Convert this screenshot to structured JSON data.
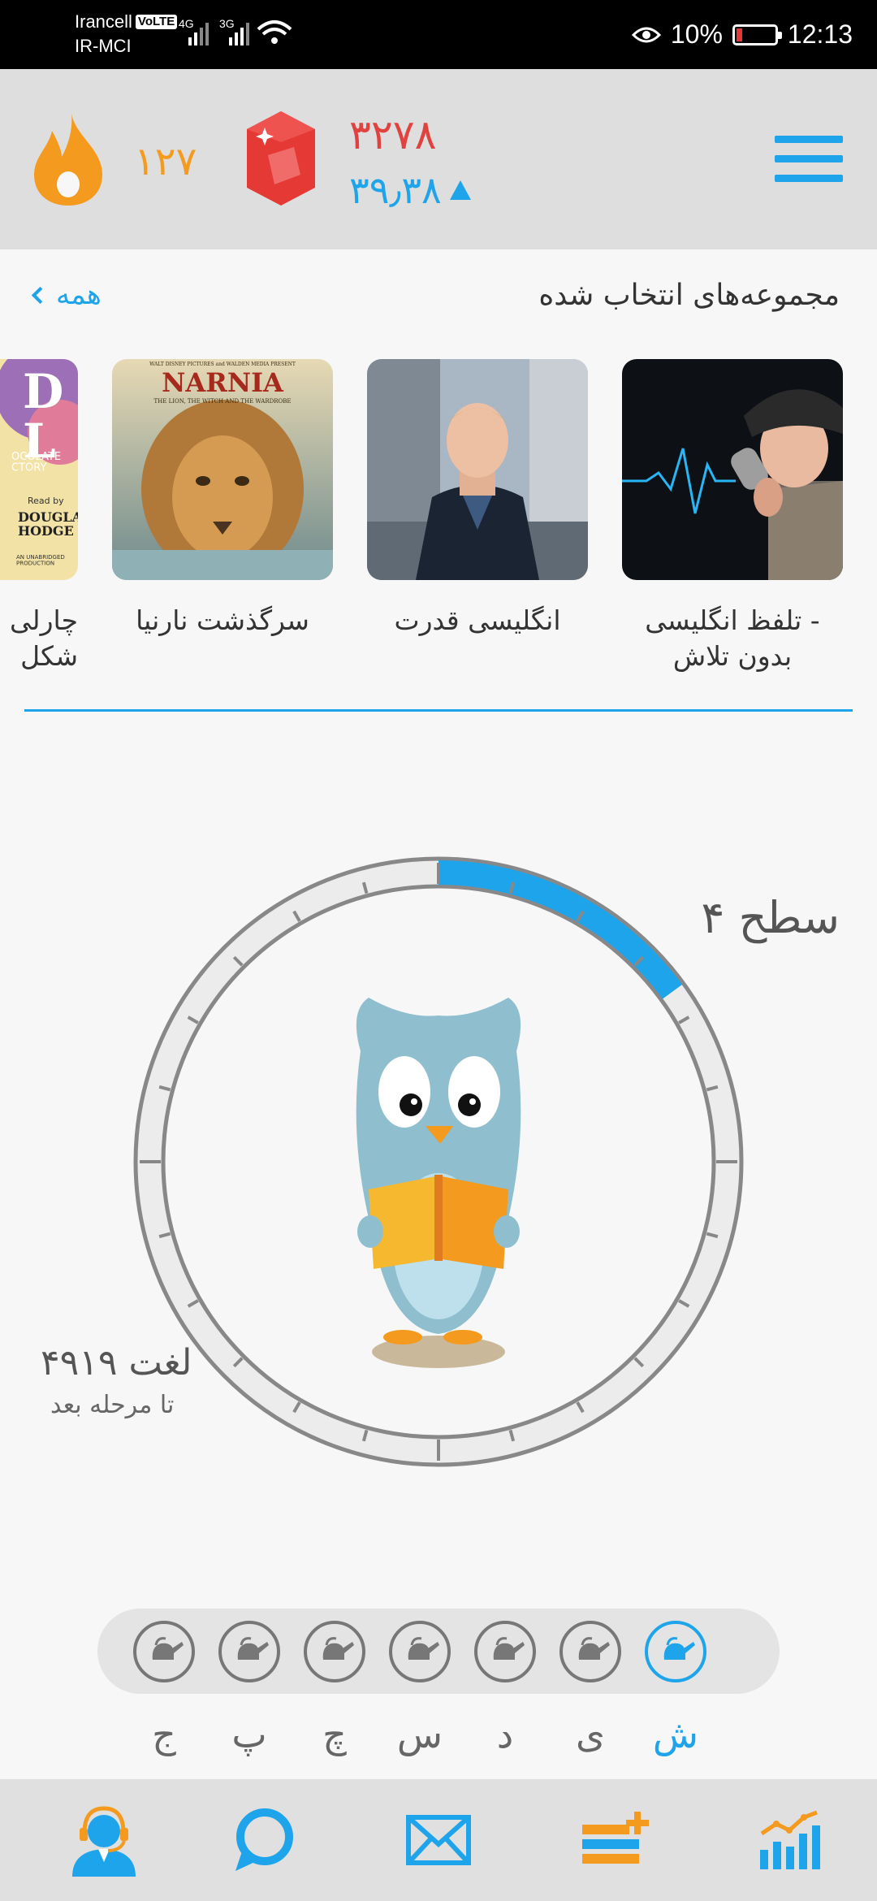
{
  "status_bar": {
    "carrier_1": "Irancell",
    "volte": "VoLTE",
    "carrier_2": "IR-MCI",
    "net_1": "4G",
    "net_2": "3G",
    "battery": "10%",
    "time": "12:13"
  },
  "header": {
    "streak": "۱۲۷",
    "points": "۳۲۷۸",
    "rank": "۳۹٫۳۸"
  },
  "collections": {
    "title": "مجموعه‌های انتخاب شده",
    "all_label": "همه",
    "items": [
      {
        "title_line1": "تلفظ انگلیسی -",
        "title_line2": "بدون تلاش"
      },
      {
        "title_line1": "انگلیسی قدرت",
        "title_line2": ""
      },
      {
        "title_line1": "سرگذشت نارنیا",
        "title_line2": ""
      },
      {
        "title_line1": "چارلی",
        "title_line2": "شکل"
      }
    ],
    "cover_text": {
      "narnia_top": "WALT DISNEY PICTURES and WALDEN MEDIA PRESENT",
      "narnia_title": "NARNIA",
      "narnia_sub": "THE LION, THE WITCH AND THE WARDROBE",
      "charlie_big": "D\nL",
      "charlie_choc": "OCOLATE\nCTORY",
      "charlie_read": "Read by",
      "charlie_narr": "DOUGLAS\nHODGE",
      "charlie_note": "AN UNABRIDGED\nPRODUCTION"
    }
  },
  "progress": {
    "level": "سطح ۴",
    "level_fraction": 0.15,
    "words": "۴۹۱۹ لغت",
    "words_sub": "تا مرحله بعد"
  },
  "days": {
    "labels": [
      "ج",
      "پ",
      "چ",
      "س",
      "د",
      "ی",
      "ش"
    ],
    "active_index": 6
  },
  "colors": {
    "accent": "#1ea4ea",
    "streak": "#f39a1f",
    "points": "#e0433f",
    "header_bg": "#dedede"
  },
  "nav": {
    "icons": [
      "support-icon",
      "chat-icon",
      "mail-icon",
      "add-list-icon",
      "stats-icon"
    ]
  }
}
